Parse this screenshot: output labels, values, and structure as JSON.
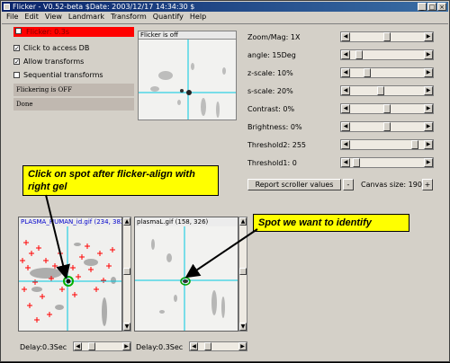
{
  "window": {
    "title": "Flicker - V0.52-beta $Date: 2003/12/17 14:34:30 $",
    "buttons": [
      "_",
      "□",
      "×"
    ]
  },
  "menu": [
    "File",
    "Edit",
    "View",
    "Landmark",
    "Transform",
    "Quantify",
    "Help"
  ],
  "left_panel": {
    "flicker_checkbox_label": "Flicker: 0.3s",
    "checkboxes": [
      {
        "label": "Click to access DB",
        "checked": true
      },
      {
        "label": "Allow transforms",
        "checked": true
      },
      {
        "label": "Sequential transforms",
        "checked": false
      }
    ],
    "status1": "Flickering is OFF",
    "status2": "Done",
    "accent_red": "#ff0000"
  },
  "flicker_view": {
    "header": "Flicker is off"
  },
  "controls": [
    {
      "label": "Zoom/Mag: 1X",
      "level": 0.5
    },
    {
      "label": "angle: 15Deg",
      "level": 0.08
    },
    {
      "label": "z-scale: 10%",
      "level": 0.2
    },
    {
      "label": "s-scale: 20%",
      "level": 0.4
    },
    {
      "label": "Contrast: 0%",
      "level": 0.5
    },
    {
      "label": "Brightness: 0%",
      "level": 0.5
    },
    {
      "label": "Threshold2: 255",
      "level": 0.92
    },
    {
      "label": "Threshold1: 0",
      "level": 0.04
    }
  ],
  "report_button": "Report scroller values",
  "canvas": {
    "minus": "-",
    "label": "Canvas size: 190",
    "plus": "+"
  },
  "gels": [
    {
      "header": "PLASMA_HUMAN_id.gif (234, 382)",
      "delay": "Delay:0.3Sec",
      "header_color": "#0000cc"
    },
    {
      "header": "plasmaL.gif (158, 326)",
      "delay": "Delay:0.3Sec",
      "header_color": "#000000"
    }
  ],
  "callouts": {
    "left": "Click on spot after flicker-align with right gel",
    "right": "Spot we want to identify"
  },
  "colors": {
    "callout_bg": "#ffff00",
    "crosshair": "#00c8e0",
    "title_bar": "#0a246a"
  }
}
